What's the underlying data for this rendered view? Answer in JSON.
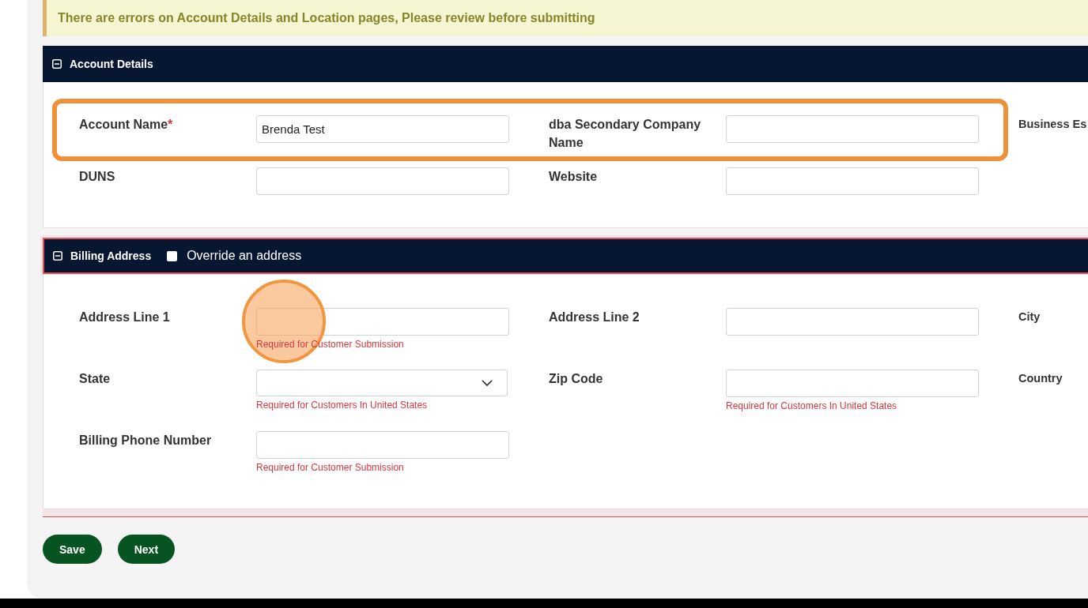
{
  "alert": {
    "text": "There are errors on Account Details and Location pages, Please review before submitting"
  },
  "sections": [
    {
      "title": "Account Details",
      "expanded": true,
      "error": false,
      "rows": [
        {
          "highlighted": true,
          "fields": [
            {
              "kind": "text",
              "label": "Account Name",
              "required_mark": "*",
              "value": "Brenda Test"
            },
            {
              "kind": "text",
              "label": "dba Secondary Company Name"
            },
            {
              "kind": "label_only",
              "label": "Business Es"
            }
          ]
        },
        {
          "highlighted": false,
          "fields": [
            {
              "kind": "text",
              "label": "DUNS"
            },
            {
              "kind": "text",
              "label": "Website"
            }
          ]
        }
      ]
    },
    {
      "title": "Billing Address",
      "expanded": true,
      "error": true,
      "option": {
        "label": "Override an address",
        "checked": false
      },
      "rows": [
        {
          "highlighted": false,
          "fields": [
            {
              "kind": "text",
              "label": "Address Line 1",
              "error": "Required for Customer Submission",
              "click_marker": true
            },
            {
              "kind": "text",
              "label": "Address Line 2"
            },
            {
              "kind": "label_only",
              "label": "City"
            }
          ]
        },
        {
          "highlighted": false,
          "fields": [
            {
              "kind": "select",
              "label": "State",
              "error": "Required for Customers In United States"
            },
            {
              "kind": "text",
              "label": "Zip Code",
              "error": "Required for Customers In United States"
            },
            {
              "kind": "label_only",
              "label": "Country"
            }
          ]
        },
        {
          "highlighted": false,
          "fields": [
            {
              "kind": "text",
              "label": "Billing Phone Number",
              "error": "Required for Customer Submission"
            }
          ]
        }
      ]
    }
  ],
  "buttons": [
    {
      "label": "Save"
    },
    {
      "label": "Next"
    }
  ]
}
